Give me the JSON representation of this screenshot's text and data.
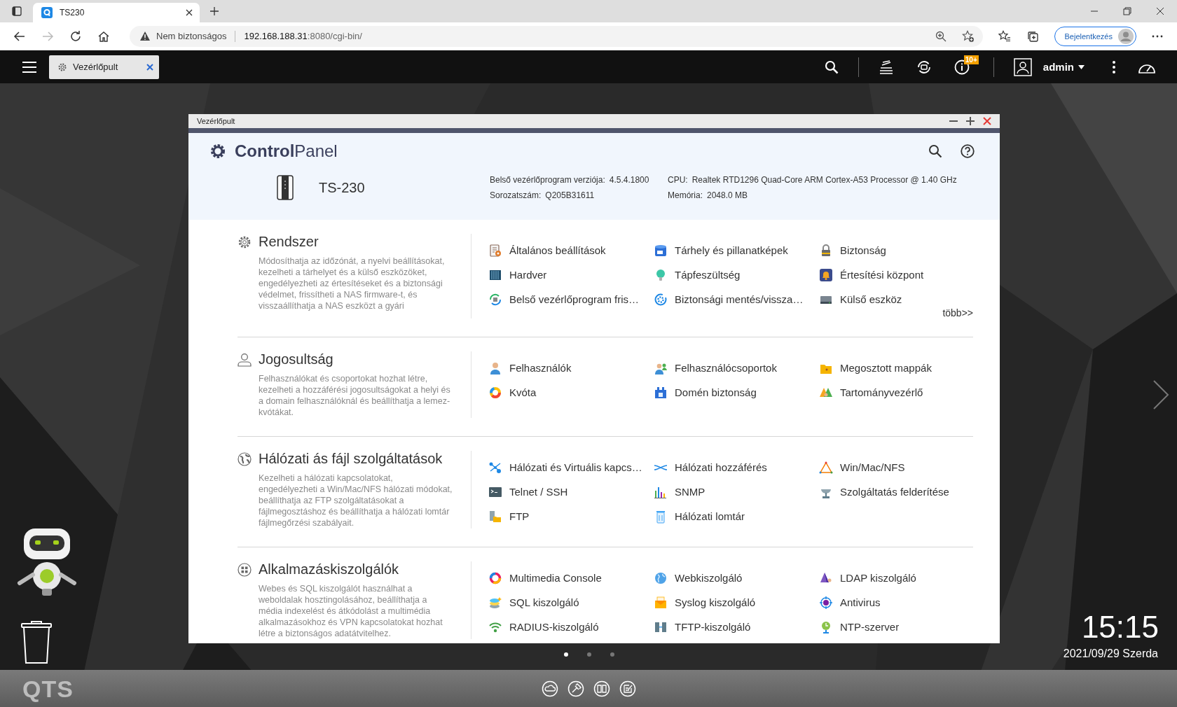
{
  "browser": {
    "tab_title": "TS230",
    "security": "Nem biztonságos",
    "url_host": "192.168.188.31",
    "url_rest": ":8080/cgi-bin/",
    "signin": "Bejelentkezés"
  },
  "qts_bar": {
    "tabs": [
      {
        "label": "Vezérlőpult",
        "selected": true
      }
    ],
    "badge": "10+",
    "user": "admin"
  },
  "window": {
    "title": "Vezérlőpult",
    "app_title": "**Control**Panel",
    "device": {
      "model": "TS-230",
      "info": [
        {
          "label": "Belső vezérlőprogram verziója:",
          "value": "4.5.4.1800"
        },
        {
          "label": "CPU:",
          "value": "Realtek RTD1296 Quad-Core ARM Cortex-A53 Processor @ 1.40 GHz"
        },
        {
          "label": "Sorozatszám:",
          "value": "Q205B31611"
        },
        {
          "label": "Memória:",
          "value": "2048.0 MB"
        }
      ]
    },
    "sections": [
      {
        "title": "Rendszer",
        "description": "Módosíthatja az időzónát, a nyelvi beállításokat, kezelheti a tárhelyet és a külső eszközöket, engedélyezheti az értesítéseket és a biztonsági védelmet, frissítheti a NAS firmware-t, és visszaállíthatja a NAS eszközt a gyári",
        "items": [
          "Általános beállítások",
          "Tárhely és pillanatképek",
          "Biztonság",
          "Hardver",
          "Tápfeszültség",
          "Értesítési központ",
          "Belső vezérlőprogram fris…",
          "Biztonsági mentés/vissza…",
          "Külső eszköz"
        ],
        "more": "több>>"
      },
      {
        "title": "Jogosultság",
        "description": "Felhasználókat és csoportokat hozhat létre, kezelheti a hozzáférési jogosultságokat a helyi és a domain felhasználóknál és beállíthatja a lemez-kvótákat.",
        "items": [
          "Felhasználók",
          "Felhasználócsoportok",
          "Megosztott mappák",
          "Kvóta",
          "Domén biztonság",
          "Tartományvezérlő"
        ]
      },
      {
        "title": "Hálózati ás fájl szolgáltatások",
        "description": "Kezelheti a hálózati kapcsolatokat, engedélyezheti a Win/Mac/NFS hálózati módokat, beállíthatja az FTP szolgáltatásokat a fájlmegosztáshoz és beállíthatja a hálózati lomtár fájlmegőrzési szabályait.",
        "items": [
          "Hálózati és Virtuális kapcs…",
          "Hálózati hozzáférés",
          "Win/Mac/NFS",
          "Telnet / SSH",
          "SNMP",
          "Szolgáltatás felderítése",
          "FTP",
          "Hálózati lomtár"
        ]
      },
      {
        "title": "Alkalmazáskiszolgálók",
        "description": "Webes és SQL kiszolgálót használhat a weboldalak hosztingolásához, beállíthatja a média indexelést és átkódolást a multimédia alkalmazásokhoz és VPN kapcsolatokat hozhat létre a biztonságos adatátvitelhez.",
        "items": [
          "Multimedia Console",
          "Webkiszolgáló",
          "LDAP kiszolgáló",
          "SQL kiszolgáló",
          "Syslog kiszolgáló",
          "Antivirus",
          "RADIUS-kiszolgáló",
          "TFTP-kiszolgáló",
          "NTP-szerver"
        ]
      }
    ]
  },
  "desktop": {
    "clock": "15:15",
    "date": "2021/09/29 Szerda",
    "pages": [
      {
        "selected": true
      },
      {
        "selected": false
      },
      {
        "selected": false
      }
    ],
    "logo": "QTS"
  }
}
